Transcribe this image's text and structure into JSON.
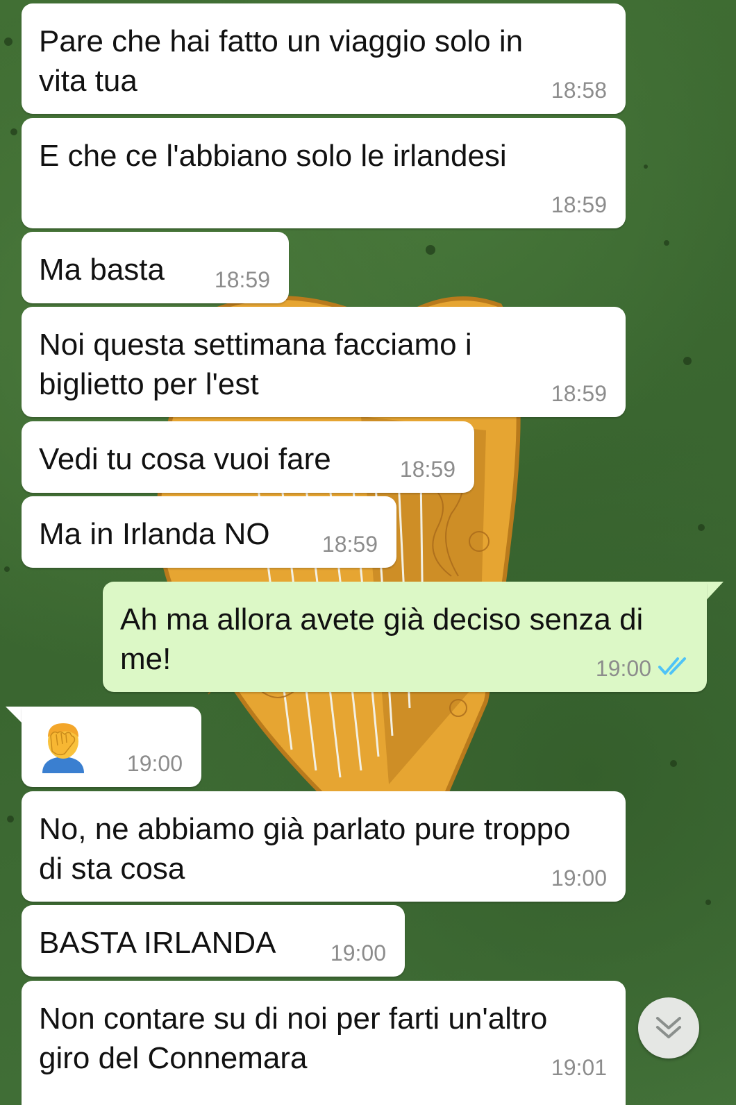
{
  "chat": {
    "messages": [
      {
        "text": "Pare che hai fatto un viaggio solo in\nvita tua",
        "time": "18:58"
      },
      {
        "text": "E che ce l'abbiano solo le irlandesi",
        "time": "18:59"
      },
      {
        "text": "Ma basta",
        "time": "18:59"
      },
      {
        "text": "Noi questa settimana facciamo i\nbiglietto per l'est",
        "time": "18:59"
      },
      {
        "text": "Vedi tu cosa vuoi fare",
        "time": "18:59"
      },
      {
        "text": "Ma in Irlanda NO",
        "time": "18:59"
      },
      {
        "text": "Ah ma allora avete già deciso senza di\nme!",
        "time": "19:00",
        "outgoing": true,
        "status": "read"
      },
      {
        "text": "",
        "emoji": "facepalm-emoji",
        "time": "19:00"
      },
      {
        "text": "No, ne abbiamo già parlato pure troppo\ndi sta cosa",
        "time": "19:00"
      },
      {
        "text": "BASTA IRLANDA",
        "time": "19:00"
      },
      {
        "text": "Non contare su di noi per farti un'altro\ngiro del Connemara",
        "time": "19:01"
      }
    ]
  },
  "colors": {
    "incoming_bubble": "#ffffff",
    "outgoing_bubble": "#dcf8c6",
    "read_ticks": "#4fc3f7",
    "timestamp": "#8c8c8c",
    "wallpaper_green": "#3f6e33",
    "harp_gold": "#e6a532"
  },
  "icons": {
    "scroll_down": "double-chevron-down-icon",
    "read_receipt": "double-check-icon"
  }
}
